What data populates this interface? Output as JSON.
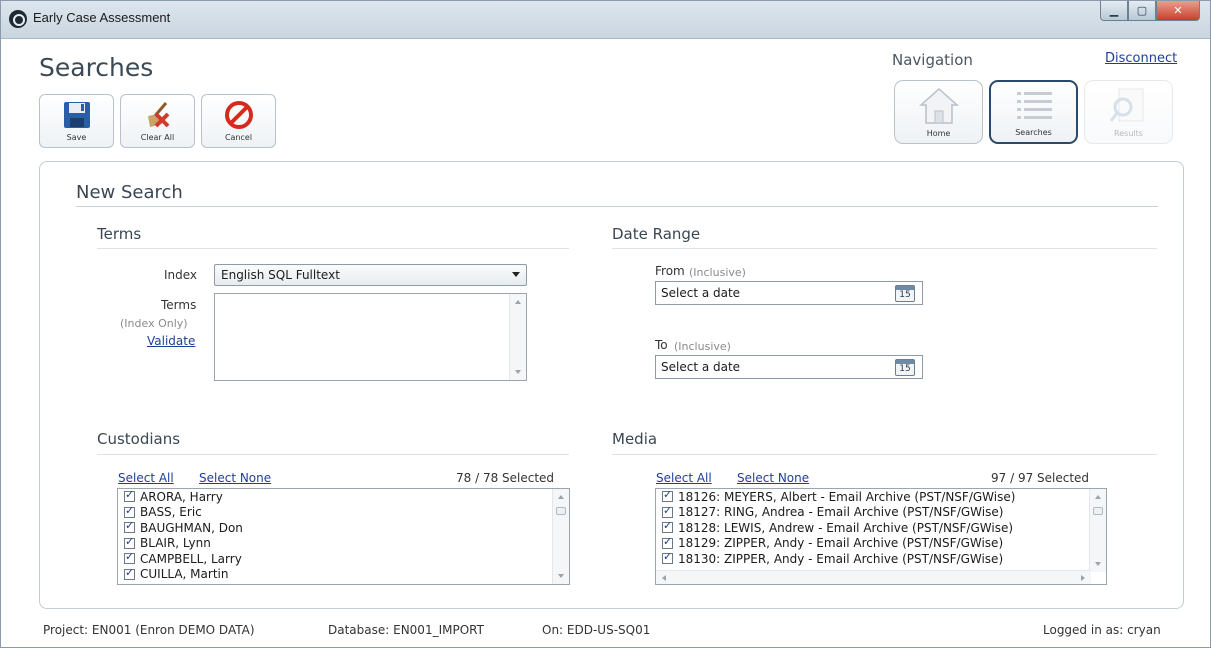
{
  "window": {
    "title": "Early Case Assessment"
  },
  "page": {
    "title": "Searches"
  },
  "toolbar": {
    "save": "Save",
    "clear_all": "Clear All",
    "cancel": "Cancel"
  },
  "navigation": {
    "label": "Navigation",
    "disconnect": "Disconnect",
    "home": "Home",
    "searches": "Searches",
    "results": "Results",
    "active": "Searches"
  },
  "new_search": {
    "title": "New Search",
    "terms": {
      "section_title": "Terms",
      "index_label": "Index",
      "index_value": "English SQL Fulltext",
      "terms_label": "Terms",
      "terms_sublabel": "(Index Only)",
      "validate": "Validate",
      "terms_value": ""
    },
    "date_range": {
      "section_title": "Date Range",
      "from_label": "From",
      "from_note": "(Inclusive)",
      "from_placeholder": "Select a date",
      "to_label": "To",
      "to_note": "(Inclusive)",
      "to_placeholder": "Select a date",
      "calendar_day": "15"
    },
    "custodians": {
      "section_title": "Custodians",
      "select_all": "Select All",
      "select_none": "Select None",
      "count": "78 / 78 Selected",
      "items": [
        {
          "label": "ARORA, Harry",
          "checked": true
        },
        {
          "label": "BASS, Eric",
          "checked": true
        },
        {
          "label": "BAUGHMAN, Don",
          "checked": true
        },
        {
          "label": "BLAIR, Lynn",
          "checked": true
        },
        {
          "label": "CAMPBELL, Larry",
          "checked": true
        },
        {
          "label": "CUILLA, Martin",
          "checked": true
        }
      ]
    },
    "media": {
      "section_title": "Media",
      "select_all": "Select All",
      "select_none": "Select None",
      "count": "97 / 97 Selected",
      "items": [
        {
          "label": "18126: MEYERS, Albert - Email Archive (PST/NSF/GWise)",
          "checked": true
        },
        {
          "label": "18127: RING, Andrea - Email Archive (PST/NSF/GWise)",
          "checked": true
        },
        {
          "label": "18128: LEWIS, Andrew - Email Archive (PST/NSF/GWise)",
          "checked": true
        },
        {
          "label": "18129: ZIPPER, Andy - Email Archive (PST/NSF/GWise)",
          "checked": true
        },
        {
          "label": "18130: ZIPPER, Andy - Email Archive (PST/NSF/GWise)",
          "checked": true
        }
      ]
    }
  },
  "status_bar": {
    "project": "Project: EN001 (Enron DEMO DATA)",
    "database": "Database: EN001_IMPORT",
    "server": "On: EDD-US-SQ01",
    "user": "Logged in as: cryan"
  },
  "colors": {
    "link": "#1f3e9a",
    "active_nav_border": "#2b4a6b",
    "close_button": "#c8402a"
  }
}
